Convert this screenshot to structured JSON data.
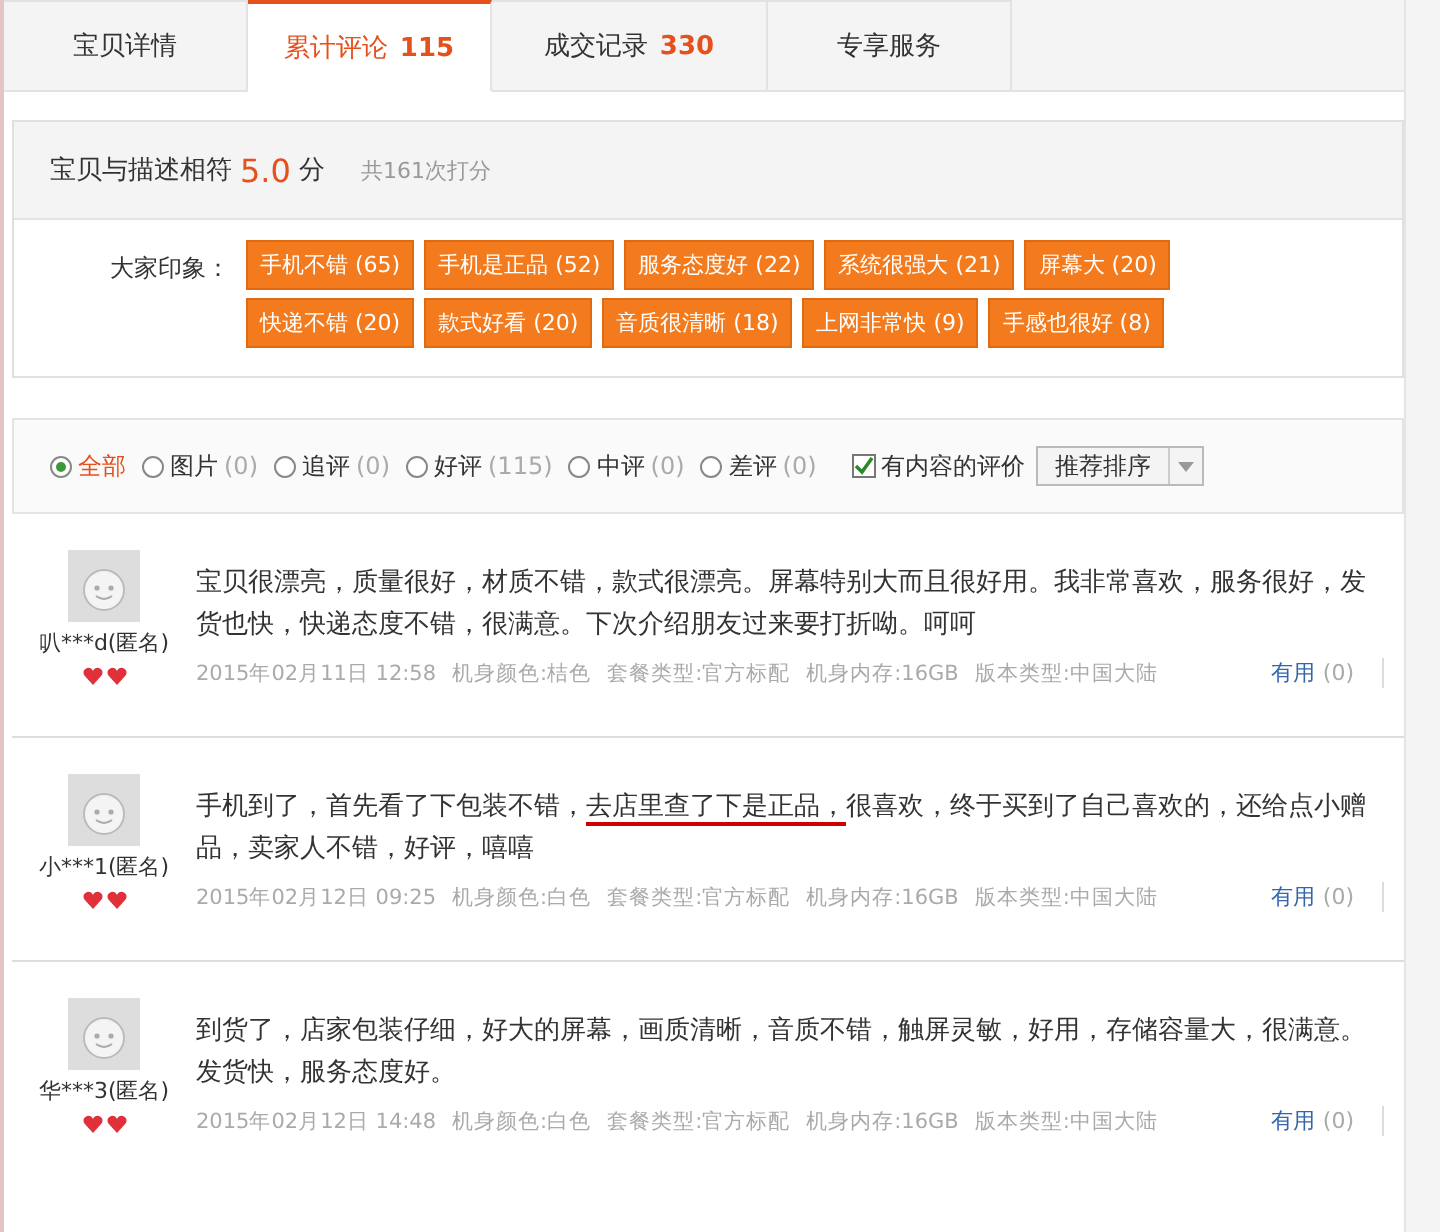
{
  "tabs": [
    {
      "label": "宝贝详情",
      "selected": false
    },
    {
      "label": "累计评论",
      "count": "115",
      "selected": true
    },
    {
      "label": "成交记录",
      "count": "330",
      "selected": false
    },
    {
      "label": "专享服务",
      "selected": false
    }
  ],
  "rating": {
    "label": "宝贝与描述相符",
    "score": "5.0",
    "unit": "分",
    "total": "共161次打分"
  },
  "impressions": {
    "label": "大家印象：",
    "tags": [
      "手机不错 (65)",
      "手机是正品 (52)",
      "服务态度好 (22)",
      "系统很强大 (21)",
      "屏幕大 (20)",
      "快递不错 (20)",
      "款式好看 (20)",
      "音质很清晰 (18)",
      "上网非常快 (9)",
      "手感也很好 (8)"
    ]
  },
  "filters": [
    {
      "label": "全部",
      "selected": true
    },
    {
      "label": "图片",
      "count": "(0)",
      "selected": false
    },
    {
      "label": "追评",
      "count": "(0)",
      "selected": false
    },
    {
      "label": "好评",
      "count": "(115)",
      "selected": false
    },
    {
      "label": "中评",
      "count": "(0)",
      "selected": false
    },
    {
      "label": "差评",
      "count": "(0)",
      "selected": false
    }
  ],
  "content_only": {
    "label": "有内容的评价",
    "checked": true
  },
  "sort": {
    "value": "推荐排序"
  },
  "reviews": [
    {
      "user": "叭***d(匿名)",
      "segments": [
        {
          "text": "宝贝很漂亮，质量很好，材质不错，款式很漂亮。屏幕特别大而且很好用。我非常喜欢，服务很好，发货也快，快递态度不错，很满意。下次介绍朋友过来要打折呦。呵呵",
          "underlined": false
        }
      ],
      "meta": [
        "2015年02月11日 12:58",
        "机身颜色:桔色",
        "套餐类型:官方标配",
        "机身内存:16GB",
        "版本类型:中国大陆"
      ],
      "useful": "有用",
      "useful_count": "(0)"
    },
    {
      "user": "小***1(匿名)",
      "segments": [
        {
          "text": "手机到了，首先看了下包装不错，",
          "underlined": false
        },
        {
          "text": "去店里查了下是正品，",
          "underlined": true
        },
        {
          "text": "很喜欢，终于买到了自己喜欢的，还给点小赠品，卖家人不错，好评，嘻嘻",
          "underlined": false
        }
      ],
      "meta": [
        "2015年02月12日 09:25",
        "机身颜色:白色",
        "套餐类型:官方标配",
        "机身内存:16GB",
        "版本类型:中国大陆"
      ],
      "useful": "有用",
      "useful_count": "(0)"
    },
    {
      "user": "华***3(匿名)",
      "segments": [
        {
          "text": "到货了，店家包装仔细，好大的屏幕，画质清晰，音质不错，触屏灵敏，好用，存储容量大，很满意。发货快，服务态度好。",
          "underlined": false
        }
      ],
      "meta": [
        "2015年02月12日 14:48",
        "机身颜色:白色",
        "套餐类型:官方标配",
        "机身内存:16GB",
        "版本类型:中国大陆"
      ],
      "useful": "有用",
      "useful_count": "(0)"
    }
  ]
}
